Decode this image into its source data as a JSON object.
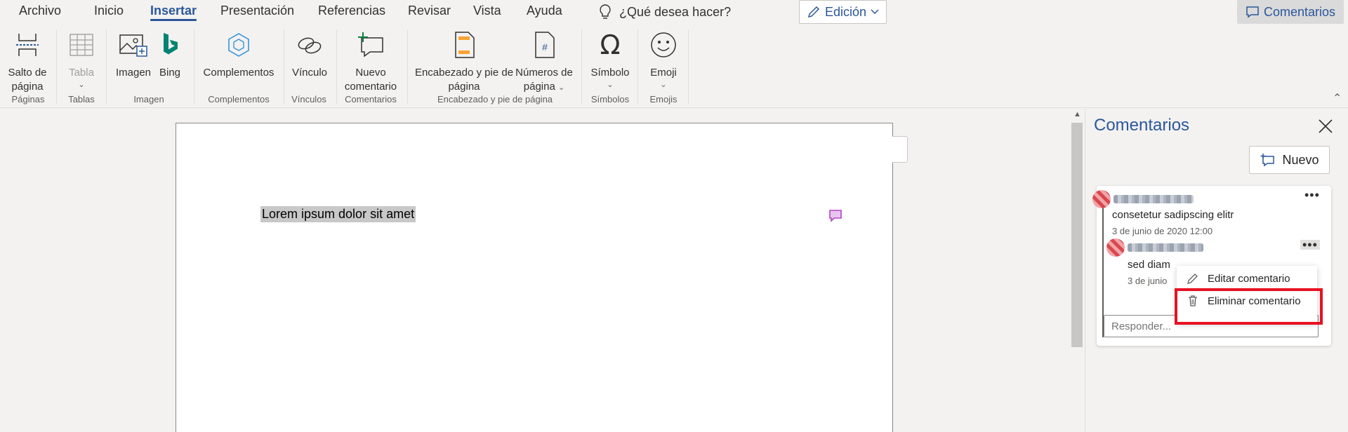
{
  "menu": {
    "tabs": [
      {
        "label": "Archivo"
      },
      {
        "label": "Inicio"
      },
      {
        "label": "Insertar"
      },
      {
        "label": "Presentación"
      },
      {
        "label": "Referencias"
      },
      {
        "label": "Revisar"
      },
      {
        "label": "Vista"
      },
      {
        "label": "Ayuda"
      }
    ],
    "active_tab": "Insertar",
    "tell_me": "¿Qué desea hacer?",
    "mode_label": "Edición",
    "comments_label": "Comentarios"
  },
  "ribbon": {
    "buttons": {
      "page_break": [
        "Salto de",
        "página"
      ],
      "table": "Tabla",
      "image": "Imagen",
      "bing": "Bing",
      "addins": "Complementos",
      "link": "Vínculo",
      "new_comment": [
        "Nuevo",
        "comentario"
      ],
      "header_footer": [
        "Encabezado y pie de",
        "página"
      ],
      "page_numbers": [
        "Números de",
        "página"
      ],
      "symbol": "Símbolo",
      "emoji": "Emoji"
    },
    "groups": {
      "pages": "Páginas",
      "tables": "Tablas",
      "images": "Imagen",
      "addins": "Complementos",
      "links": "Vínculos",
      "comments": "Comentarios",
      "header_footer": "Encabezado y pie de página",
      "symbols": "Símbolos",
      "emojis": "Emojis"
    }
  },
  "document": {
    "text": "Lorem ipsum dolor sit amet"
  },
  "comments_pane": {
    "title": "Comentarios",
    "new_button": "Nuevo",
    "thread": {
      "first_comment": {
        "text": "consetetur sadipscing elitr",
        "date": "3 de junio de 2020 12:00"
      },
      "reply": {
        "text": "sed diam",
        "date": "3 de junio"
      },
      "reply_placeholder": "Responder..."
    },
    "context_menu": {
      "edit": "Editar comentario",
      "delete": "Eliminar comentario"
    }
  },
  "colors": {
    "accent": "#2b579a",
    "highlight": "#e81123",
    "comment_marker": "#b146c2"
  }
}
